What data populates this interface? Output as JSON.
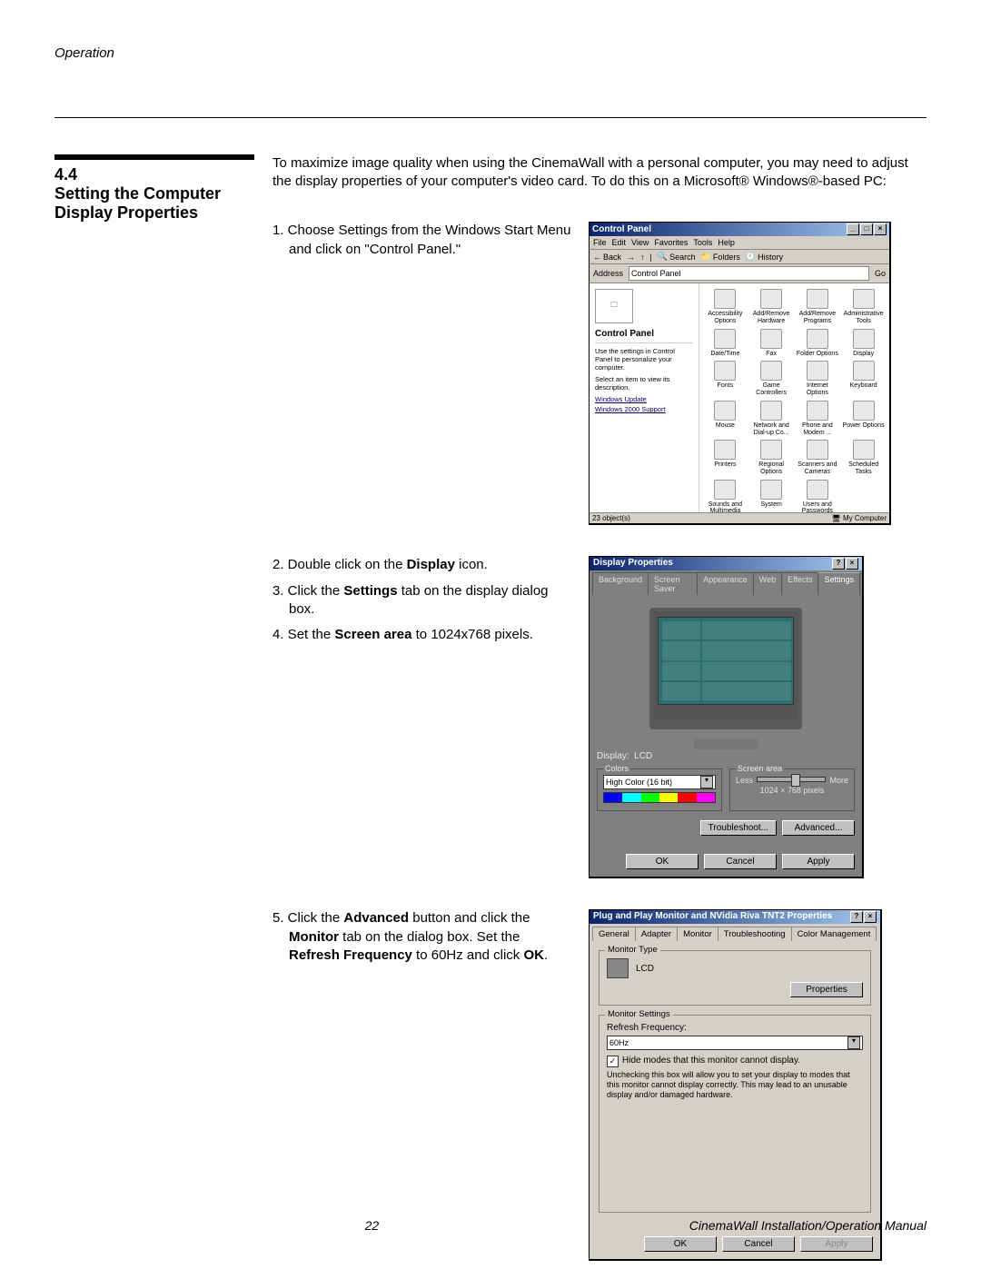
{
  "running_head": "Operation",
  "section": {
    "number": "4.4",
    "title": "Setting the Computer Display Properties"
  },
  "intro": "To maximize image quality when using the CinemaWall with a personal computer, you may need to adjust the display properties of your computer's video card. To do this on a Microsoft® Windows®-based PC:",
  "steps": {
    "s1_prefix": "1.",
    "s1_text": " Choose Settings from the Windows Start Menu and click on \"Control Panel.\"",
    "s2_prefix": "2.",
    "s2a": " Double click on the ",
    "s2b": "Display",
    "s2c": " icon.",
    "s3_prefix": "3.",
    "s3a": " Click the ",
    "s3b": "Settings",
    "s3c": " tab on the display dialog box.",
    "s4_prefix": "4.",
    "s4a": " Set the ",
    "s4b": "Screen area",
    "s4c": " to 1024x768 pixels.",
    "s5_prefix": "5.",
    "s5a": " Click the ",
    "s5b": "Advanced",
    "s5c": " button and click the ",
    "s5d": "Monitor",
    "s5e": " tab on the dialog box. Set the ",
    "s5f": "Refresh Frequency",
    "s5g": " to 60Hz and click ",
    "s5h": "OK",
    "s5i": "."
  },
  "control_panel": {
    "title": "Control Panel",
    "menu": [
      "File",
      "Edit",
      "View",
      "Favorites",
      "Tools",
      "Help"
    ],
    "toolbar": [
      "Back",
      "→",
      "↑",
      "Search",
      "Folders",
      "History"
    ],
    "address_label": "Address",
    "address_value": "Control Panel",
    "go": "Go",
    "left_heading": "Control Panel",
    "left_desc1": "Use the settings in Control Panel to personalize your computer.",
    "left_desc2": "Select an item to view its description.",
    "left_links": [
      "Windows Update",
      "Windows 2000 Support"
    ],
    "icons": [
      "Accessibility Options",
      "Add/Remove Hardware",
      "Add/Remove Programs",
      "Administrative Tools",
      "Date/Time",
      "Fax",
      "Folder Options",
      "Display",
      "Fonts",
      "Game Controllers",
      "Internet Options",
      "Keyboard",
      "Mouse",
      "Network and Dial-up Co...",
      "Phone and Modem ...",
      "Power Options",
      "Printers",
      "Regional Options",
      "Scanners and Cameras",
      "Scheduled Tasks",
      "Sounds and Multimedia",
      "System",
      "Users and Passwords"
    ],
    "status_left": "23 object(s)",
    "status_right": "My Computer"
  },
  "display_props": {
    "title": "Display Properties",
    "tabs": [
      "Background",
      "Screen Saver",
      "Appearance",
      "Web",
      "Effects",
      "Settings"
    ],
    "display_label": "Display:",
    "display_value": "LCD",
    "colors_group": "Colors",
    "colors_value": "High Color (16 bit)",
    "screenarea_group": "Screen area",
    "less": "Less",
    "more": "More",
    "resolution": "1024 × 768 pixels",
    "troubleshoot": "Troubleshoot...",
    "advanced": "Advanced...",
    "ok": "OK",
    "cancel": "Cancel",
    "apply": "Apply"
  },
  "monitor_props": {
    "title": "Plug and Play Monitor and NVidia Riva TNT2 Properties",
    "tabs": [
      "General",
      "Adapter",
      "Monitor",
      "Troubleshooting",
      "Color Management"
    ],
    "monitor_type_group": "Monitor Type",
    "monitor_type_value": "LCD",
    "properties_btn": "Properties",
    "monitor_settings_group": "Monitor Settings",
    "refresh_label": "Refresh Frequency:",
    "refresh_value": "60Hz",
    "hide_modes": "Hide modes that this monitor cannot display.",
    "warning": "Unchecking this box will allow you to set your display to modes that this monitor cannot display correctly. This may lead to an unusable display and/or damaged hardware.",
    "ok": "OK",
    "cancel": "Cancel",
    "apply": "Apply"
  },
  "footer": {
    "page": "22",
    "doc": "CinemaWall Installation/Operation Manual"
  }
}
